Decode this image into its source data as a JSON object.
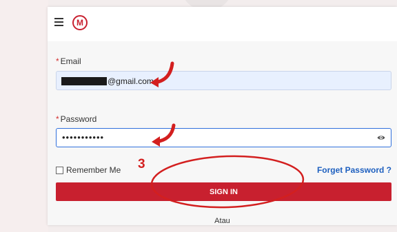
{
  "header": {
    "menu_icon": "hamburger-icon",
    "logo_letter": "M",
    "logo_icon": "brand-logo-icon"
  },
  "form": {
    "email": {
      "label": "Email",
      "value_suffix": "@gmail.com"
    },
    "password": {
      "label": "Password",
      "value": "•••••••••••",
      "toggle_icon": "eye-icon"
    },
    "remember_label": "Remember Me",
    "forget_label": "Forget Password ?",
    "signin_label": "SIGN IN",
    "or_label": "Atau"
  },
  "annotation": {
    "step_number": "3"
  },
  "colors": {
    "brand_red": "#c8202f",
    "link_blue": "#1d5fbf",
    "annotation_red": "#d31f1f",
    "focus_blue": "#2f6fdc"
  }
}
